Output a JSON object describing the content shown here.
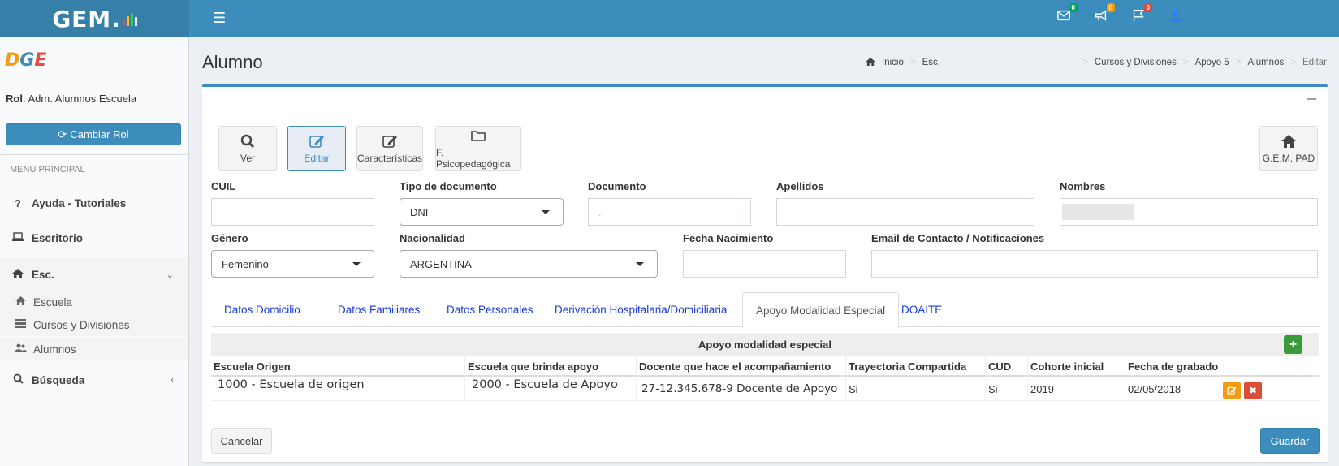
{
  "header": {
    "logo_text": "GEM",
    "colors": {
      "topbar": "#3c8dbc",
      "logo_bg": "#367fa9"
    },
    "notifications": [
      {
        "icon": "envelope-icon",
        "count": "0",
        "badge_color": "#00a65a"
      },
      {
        "icon": "bullhorn-icon",
        "count": "0",
        "badge_color": "#f39c12"
      },
      {
        "icon": "flag-icon",
        "count": "0",
        "badge_color": "#dd4b39"
      }
    ]
  },
  "sidebar": {
    "brand": "DGE",
    "role_label": "Rol",
    "role_value": ": Adm. Alumnos Escuela",
    "change_role_button": "Cambiar Rol",
    "menu_header": "MENU PRINCIPAL",
    "items": [
      {
        "label": "Ayuda - Tutoriales",
        "icon": "question-icon"
      },
      {
        "label": "Escritorio",
        "icon": "laptop-icon"
      },
      {
        "label": "Esc.",
        "icon": "home-icon"
      },
      {
        "label": "Búsqueda",
        "icon": "search-icon"
      }
    ],
    "sub_items": [
      {
        "label": "Escuela",
        "icon": "home-icon"
      },
      {
        "label": "Cursos y Divisiones",
        "icon": "list-icon"
      },
      {
        "label": "Alumnos",
        "icon": "users-icon"
      }
    ]
  },
  "content": {
    "title": "Alumno",
    "breadcrumb_left": [
      "Inicio",
      "Esc."
    ],
    "breadcrumb_right": [
      "Cursos y Divisiones",
      "Apoyo 5",
      "Alumnos",
      "Editar"
    ]
  },
  "toolbar": {
    "ver": "Ver",
    "editar": "Editar",
    "caracteristicas": "Características",
    "psicopedagogica": "F. Psicopedagógica",
    "gem_pad": "G.E.M. PAD"
  },
  "form": {
    "cuil_label": "CUIL",
    "cuil_value": "",
    "tipo_doc_label": "Tipo de documento",
    "tipo_doc_value": "DNI",
    "documento_label": "Documento",
    "documento_value": ".",
    "apellidos_label": "Apellidos",
    "apellidos_value": "",
    "nombres_label": "Nombres",
    "genero_label": "Género",
    "genero_value": "Femenino",
    "nacionalidad_label": "Nacionalidad",
    "nacionalidad_value": "ARGENTINA",
    "fecha_nac_label": "Fecha Nacimiento",
    "fecha_nac_value": "",
    "email_label": "Email de Contacto / Notificaciones",
    "email_value": ""
  },
  "tabs": [
    "Datos Domicilio",
    "Datos Familiares",
    "Datos Personales",
    "Derivación Hospitalaria/Domiciliaria",
    "Apoyo Modalidad Especial",
    "DOAITE"
  ],
  "table": {
    "title": "Apoyo modalidad especial",
    "add_symbol": "+",
    "headers": [
      "Escuela Origen",
      "Escuela que brinda apoyo",
      "Docente que hace el acompañamiento",
      "Trayectoria Compartida",
      "CUD",
      "Cohorte inicial",
      "Fecha de grabado"
    ],
    "rows": [
      [
        "1000 - Escuela de origen",
        "2000 - Escuela de Apoyo",
        "27-12.345.678-9 Docente de Apoyo",
        "Si",
        "Si",
        "2019",
        "02/05/2018"
      ]
    ]
  },
  "footer": {
    "cancel": "Cancelar",
    "save": "Guardar"
  }
}
